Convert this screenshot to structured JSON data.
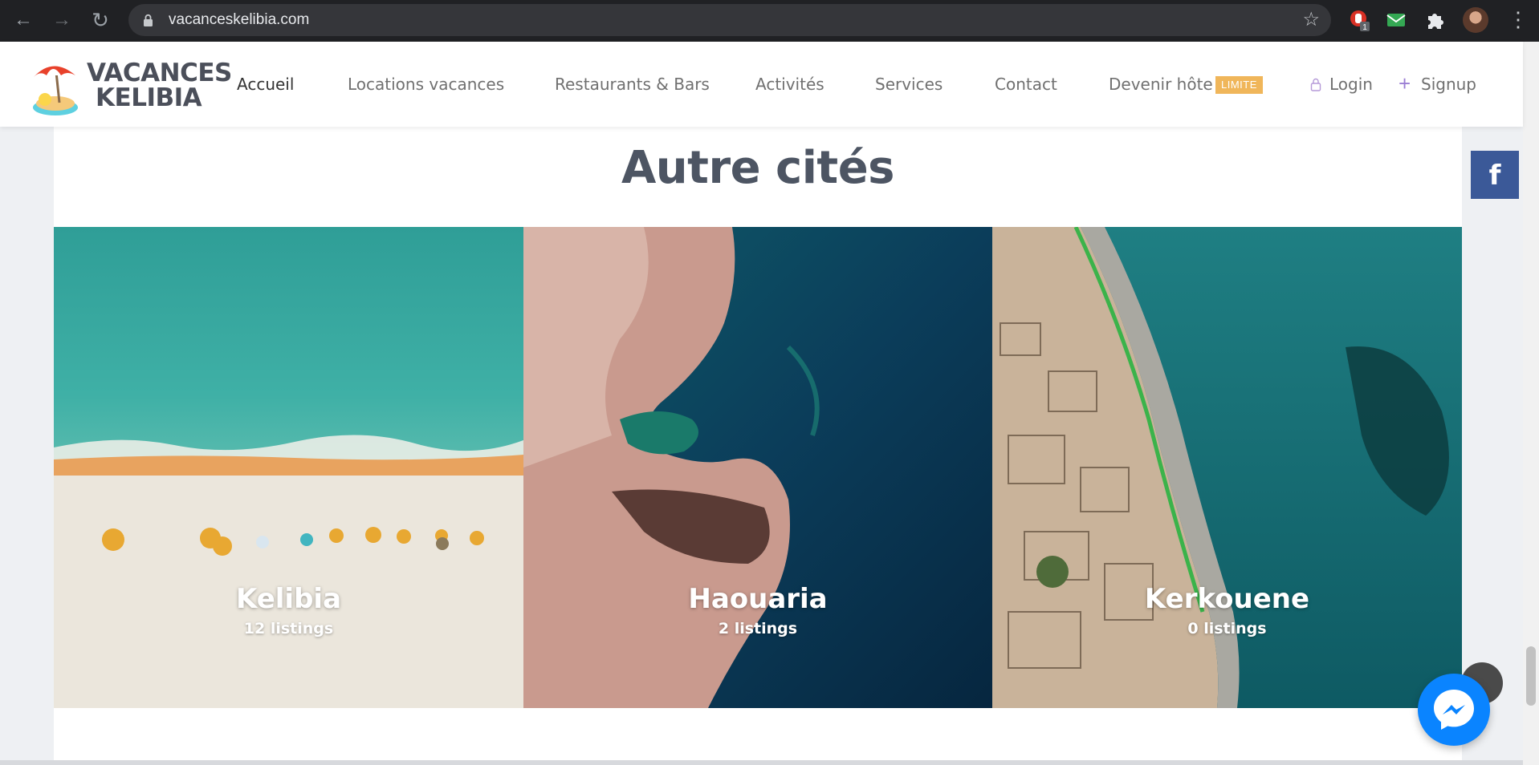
{
  "browser": {
    "url": "vacanceskelibia.com",
    "extension_badge": "1",
    "icons": [
      "back-arrow-icon",
      "forward-arrow-icon",
      "reload-icon",
      "lock-icon",
      "star-icon",
      "extension-icon",
      "puzzle-icon",
      "profile-avatar",
      "more-vert-icon"
    ]
  },
  "header": {
    "logo_line1": "VACANCES",
    "logo_line2": "KELIBIA",
    "nav": [
      {
        "label": "Accueil",
        "active": true
      },
      {
        "label": "Locations vacances"
      },
      {
        "label": "Restaurants & Bars"
      },
      {
        "label": "Activités"
      },
      {
        "label": "Services"
      },
      {
        "label": "Contact"
      },
      {
        "label": "Devenir hôte",
        "badge": "LIMITE"
      }
    ],
    "login_label": "Login",
    "signup_label": "Signup"
  },
  "section": {
    "title": "Autre cités"
  },
  "cities": [
    {
      "name": "Kelibia",
      "count": "12 listings"
    },
    {
      "name": "Haouaria",
      "count": "2 listings"
    },
    {
      "name": "Kerkouene",
      "count": "0 listings"
    }
  ],
  "floating": {
    "facebook_glyph": "f"
  },
  "colors": {
    "brand_text": "#4d5563",
    "badge_bg": "#f0b65a",
    "signup_accent": "#9b7fd4",
    "facebook": "#3b5998",
    "messenger": "#0a84ff"
  }
}
